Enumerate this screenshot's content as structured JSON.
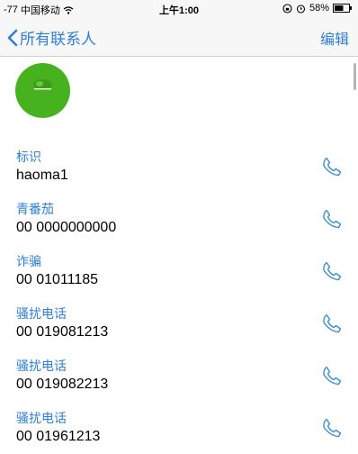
{
  "status_bar": {
    "signal": "-77",
    "carrier": "中国移动",
    "wifi_icon": "wifi-icon",
    "time": "上午1:00",
    "battery": "58%",
    "icons": [
      "lock-rotation-icon",
      "alarm-icon",
      "battery-icon"
    ]
  },
  "nav": {
    "back_label": "所有联系人",
    "edit_label": "编辑"
  },
  "avatar": {
    "color": "#46b21d"
  },
  "entries": [
    {
      "label": "标识",
      "number": "haoma1"
    },
    {
      "label": "青番茄",
      "number": "00 0000000000"
    },
    {
      "label": "诈骗",
      "number": "00 01011185"
    },
    {
      "label": "骚扰电话",
      "number": "00 019081213"
    },
    {
      "label": "骚扰电话",
      "number": "00 019082213"
    },
    {
      "label": "骚扰电话",
      "number": "00 01961213"
    }
  ],
  "colors": {
    "accent": "#2f7fd8",
    "bar_background": "#f7f7f7"
  }
}
